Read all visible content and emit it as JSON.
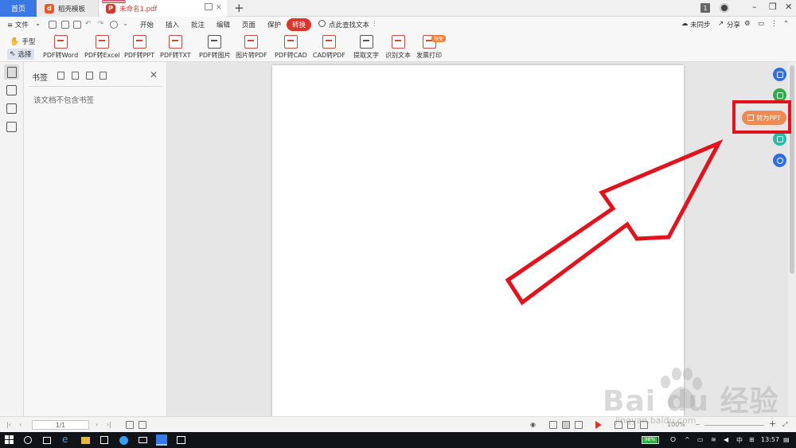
{
  "titlebar": {
    "home_tab": "首页",
    "tab1": "稻壳模板",
    "tab2": "未命名1.pdf",
    "new_tab": "+",
    "badge": "1"
  },
  "menubar": {
    "file": "≡ 文件",
    "items": [
      "开始",
      "插入",
      "批注",
      "编辑",
      "页面",
      "保护",
      "转换"
    ],
    "search": "点此查找文本",
    "sync": "未同步",
    "share": "分享"
  },
  "ribbon": {
    "hand": "手型",
    "select": "选择",
    "buttons": [
      "PDF转Word",
      "PDF转Excel",
      "PDF转PPT",
      "PDF转TXT",
      "PDF转图片",
      "图片转PDF",
      "PDF转CAD",
      "CAD转PDF",
      "提取文字",
      "识别文本",
      "发票打印"
    ],
    "hot_badge": "限免"
  },
  "bookmark": {
    "title": "书签",
    "empty": "该文档不包含书签"
  },
  "float": {
    "to_ppt": "转为PPT",
    "colors": [
      "#2f6fe0",
      "#2eae4a",
      "#f08a54",
      "#2ab8a8",
      "#2f6fe0"
    ]
  },
  "statusbar": {
    "page": "1/1",
    "zoom": "100%"
  },
  "taskbar": {
    "battery": "98%",
    "ime": "中",
    "time": "13:57"
  },
  "watermark": {
    "brand": "Bai du 经验",
    "url": "jingyan.baidu.com"
  },
  "colors": {
    "accent": "#d9362c",
    "highlight_box": "#e0141e",
    "home_tab": "#3a78e6"
  }
}
